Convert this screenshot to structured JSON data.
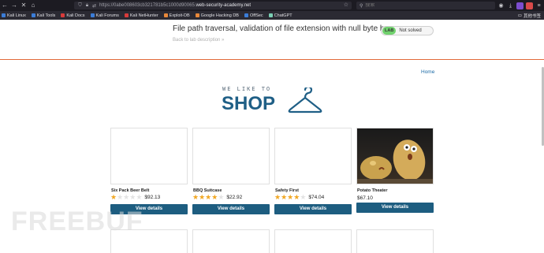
{
  "browser": {
    "url_prefix": "https://0abe008603cb321781b5c1000d90065.",
    "url_domain": "web-security-academy.net",
    "search_placeholder": "搜索",
    "bookmarks": [
      {
        "label": "Kali Linux",
        "color": "#3b7dd8"
      },
      {
        "label": "Kali Tools",
        "color": "#3b7dd8"
      },
      {
        "label": "Kali Docs",
        "color": "#d83b3b"
      },
      {
        "label": "Kali Forums",
        "color": "#3b7dd8"
      },
      {
        "label": "Kali NetHunter",
        "color": "#d83b3b"
      },
      {
        "label": "Exploit-DB",
        "color": "#e8883a"
      },
      {
        "label": "Google Hacking DB",
        "color": "#e8883a"
      },
      {
        "label": "OffSec",
        "color": "#3b7dd8"
      },
      {
        "label": "ChatGPT",
        "color": "#7acfb4"
      }
    ],
    "other_bookmarks": "其他书签"
  },
  "lab": {
    "title": "File path traversal, validation of file extension with null byte bypass",
    "back_link": "Back to lab description",
    "tag": "LAB",
    "status": "Not solved"
  },
  "nav": {
    "home": "Home"
  },
  "logo": {
    "tagline": "WE LIKE TO",
    "word": "SHOP"
  },
  "products": [
    {
      "name": "Six Pack Beer Belt",
      "rating": 1,
      "price": "$92.13",
      "button": "View details"
    },
    {
      "name": "BBQ Suitcase",
      "rating": 4,
      "price": "$22.92",
      "button": "View details"
    },
    {
      "name": "Safety First",
      "rating": 4,
      "price": "$74.04",
      "button": "View details"
    },
    {
      "name": "Potato Theater",
      "rating": 0,
      "price": "$67.10",
      "button": "View details"
    }
  ],
  "watermark": "FREEBUF",
  "colors": {
    "accent": "#1d5d80",
    "lab_header_border": "#e26a3a",
    "lab_tag": "#70d16d",
    "star": "#f1a722"
  }
}
